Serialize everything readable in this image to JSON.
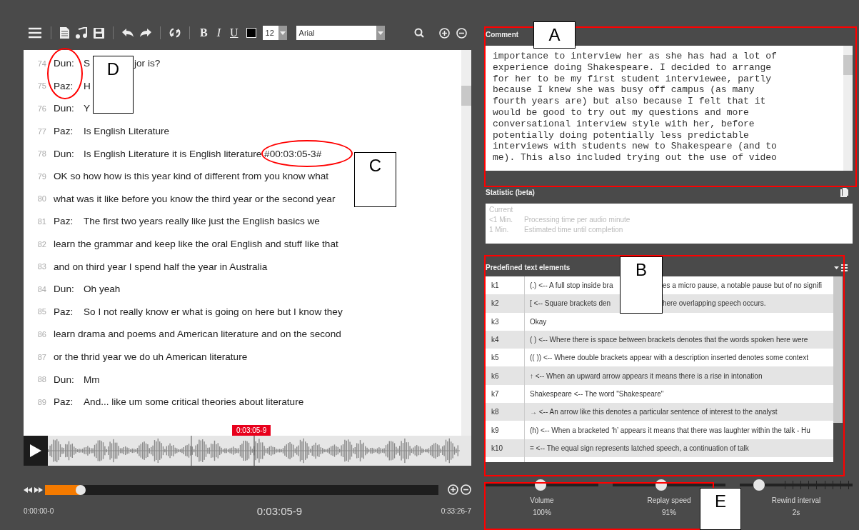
{
  "toolbar": {
    "format_buttons": [
      {
        "label": "B",
        "kind": "bold"
      },
      {
        "label": "I",
        "kind": "italic"
      },
      {
        "label": "U",
        "kind": "underline"
      }
    ],
    "font_size": "12",
    "font": "Arial"
  },
  "transcript": [
    {
      "number": "74",
      "speaker": "Dun:",
      "text": "S",
      "after": "jor is?"
    },
    {
      "number": "75",
      "speaker": "Paz:",
      "text": "H"
    },
    {
      "number": "76",
      "speaker": "Dun:",
      "text": "Y"
    },
    {
      "number": "77",
      "speaker": "Paz:",
      "text": "Is English Literature"
    },
    {
      "number": "78",
      "speaker": "Dun:",
      "text": "Is English Literature it is English literature  #00:03:05-3#"
    },
    {
      "number": "79",
      "text": "OK so how how is this year kind of different from you know what"
    },
    {
      "number": "80",
      "text": "what was it like before you know the third year or the second year"
    },
    {
      "number": "81",
      "speaker": "Paz:",
      "text": "The first two years really like just the English basics we"
    },
    {
      "number": "82",
      "text": "learn the grammar and keep like the oral English and stuff like that"
    },
    {
      "number": "83",
      "text": "and on third year I spend half the year in Australia"
    },
    {
      "number": "84",
      "speaker": "Dun:",
      "text": "Oh yeah"
    },
    {
      "number": "85",
      "speaker": "Paz:",
      "text": "So I not really know er what is going on here but I know they"
    },
    {
      "number": "86",
      "text": "learn drama and poems and American literature and on the second"
    },
    {
      "number": "87",
      "text": "or the thrid year we do uh American literature"
    },
    {
      "number": "88",
      "speaker": "Dun:",
      "text": "Mm"
    },
    {
      "number": "89",
      "speaker": "Paz:",
      "text": "And... like um some critical theories about literature"
    }
  ],
  "cursor_label": "0:03:05-9",
  "player": {
    "level": 0.09,
    "start": "0:00:00-0",
    "current": "0:03:05-9",
    "end": "0:33:26-7"
  },
  "comment": {
    "title": "Comment",
    "lines": [
      "importance to interview her as she has had a lot of",
      "experience doing Shakespeare. I decided to arrange",
      "for her to be my first student interviewee, partly",
      "because I knew she was busy off campus (as many",
      "fourth years are) but also because I felt that it",
      "would be good to try out my questions and more",
      "conversational interview style with her, before",
      "potentially doing potentially less predictable",
      "interviews with students new to Shakespeare (and to",
      "me). This also included trying out the use of video"
    ]
  },
  "statistic": {
    "title": "Statistic (beta)",
    "heading": "Current",
    "rows": [
      {
        "value": "<1 Min.",
        "label": "Processing time per audio minute"
      },
      {
        "value": "1 Min.",
        "label": "Estimated time until completion"
      }
    ]
  },
  "predefined": {
    "title": "Predefined text elements",
    "rows": [
      {
        "key": "k1",
        "text": "(.) <-- A full stop inside bra",
        "after": "es a micro pause, a notable pause but of no signifi"
      },
      {
        "key": "k2",
        "text": "[ <-- Square brackets den",
        "after": "here overlapping speech occurs."
      },
      {
        "key": "k3",
        "text": "Okay"
      },
      {
        "key": "k4",
        "text": "( ) <-- Where there is space between brackets denotes that the words spoken here were"
      },
      {
        "key": "k5",
        "text": "(( )) <-- Where double brackets appear with a description inserted denotes some context"
      },
      {
        "key": "k6",
        "text": "↑ <-- When an upward arrow appears it means there is a rise in intonation"
      },
      {
        "key": "k7",
        "text": "Shakespeare <-- The word \"Shakespeare\""
      },
      {
        "key": "k8",
        "text": "→ <-- An arrow like this denotes a particular sentence of interest to the analyst"
      },
      {
        "key": "k9",
        "text": "(h) <-- When a bracketed ‘h’ appears it means that there was laughter within the talk - Hu"
      },
      {
        "key": "k10",
        "text": "= <-- The equal sign represents latched speech, a continuation of talk"
      }
    ]
  },
  "sliders": [
    {
      "label": "Volume",
      "value": "100%",
      "level": 0.49,
      "kind": "plain"
    },
    {
      "label": "Replay speed",
      "value": "91%",
      "level": 0.43,
      "kind": "plain"
    },
    {
      "label": "Rewind interval",
      "value": "2s",
      "level": 0.17,
      "kind": "ticked"
    }
  ],
  "annotations": [
    "A",
    "B",
    "C",
    "D",
    "E"
  ]
}
